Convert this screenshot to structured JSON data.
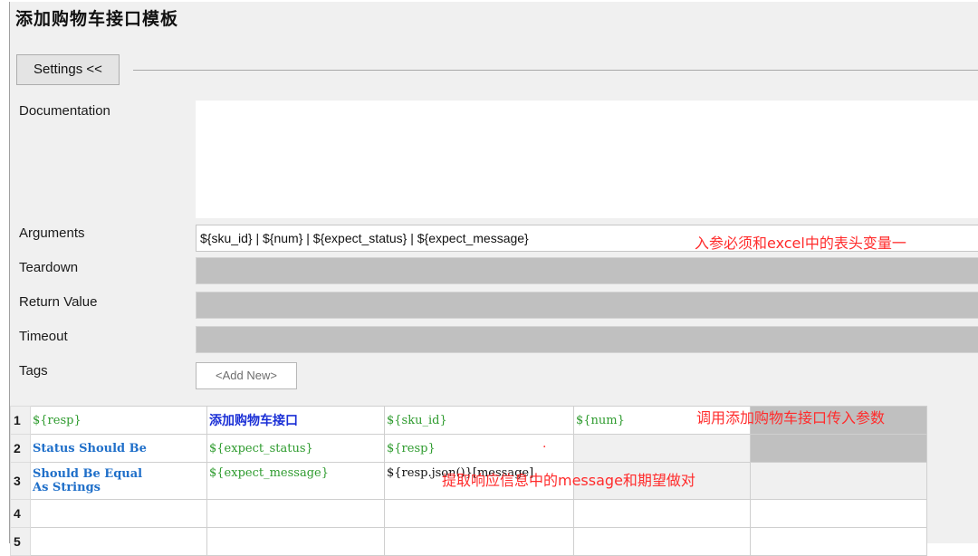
{
  "page_title": "添加购物车接口模板",
  "settings_button": "Settings <<",
  "labels": {
    "documentation": "Documentation",
    "arguments": "Arguments",
    "teardown": "Teardown",
    "return_value": "Return Value",
    "timeout": "Timeout",
    "tags": "Tags"
  },
  "arguments_value": "${sku_id} | ${num} | ${expect_status} | ${expect_message}",
  "arguments_annotation": "入参必须和excel中的表头变量一",
  "tags_add": "<Add New>",
  "grid": {
    "row_numbers": [
      "1",
      "2",
      "3",
      "4",
      "5"
    ],
    "rows": [
      [
        "${resp}",
        "添加购物车接口",
        "${sku_id}",
        "${num}",
        "调用添加购物车接口传入参数"
      ],
      [
        "Status Should Be",
        "${expect_status}",
        "${resp}",
        "",
        ""
      ],
      [
        "Should Be Equal\nAs Strings",
        "${expect_message}",
        "${resp.json()}[message]",
        "提取响应信息中的message和期望做对",
        ""
      ],
      [
        "",
        "",
        "",
        "",
        ""
      ],
      [
        "",
        "",
        "",
        "",
        ""
      ]
    ],
    "red_marker": "."
  },
  "colors": {
    "variable_green": "#2e9b2e",
    "keyword_blue": "#1f6fc9",
    "annotation_red": "#ff2b2b",
    "disabled_gray": "#c0c0c0"
  }
}
